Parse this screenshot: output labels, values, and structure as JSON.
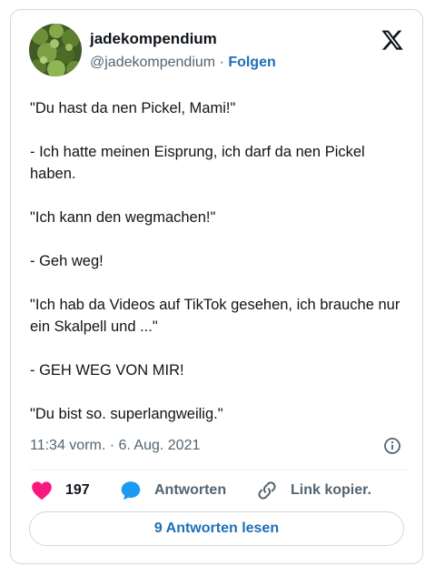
{
  "author": {
    "display_name": "jadekompendium",
    "handle": "@jadekompendium",
    "separator": " · ",
    "follow_label": "Folgen"
  },
  "icons": {
    "avatar": "plant-avatar",
    "brand": "x-logo-icon",
    "info": "info-icon",
    "like": "heart-icon",
    "reply": "speech-bubble-icon",
    "link": "link-icon"
  },
  "tweet": {
    "lines": [
      "\"Du hast da nen Pickel, Mami!\"",
      "- Ich hatte meinen Eisprung, ich darf da nen Pickel haben.",
      "\"Ich kann den wegmachen!\"",
      "- Geh weg!",
      "\"Ich hab da Videos auf TikTok gesehen, ich brauche nur ein Skalpell und ...\"",
      "- GEH WEG VON MIR!",
      "\"Du bist so. superlangweilig.\""
    ],
    "timestamp": "11:34 vorm. · 6. Aug. 2021"
  },
  "actions": {
    "like_count": "197",
    "reply_label": "Antworten",
    "link_label": "Link kopier."
  },
  "read_replies_label": "9 Antworten lesen",
  "colors": {
    "heart": "#f91880",
    "reply_bubble": "#1d9bf0",
    "link_blue": "#1d6fb8",
    "secondary_text": "#536471",
    "border": "#cfd9de"
  }
}
